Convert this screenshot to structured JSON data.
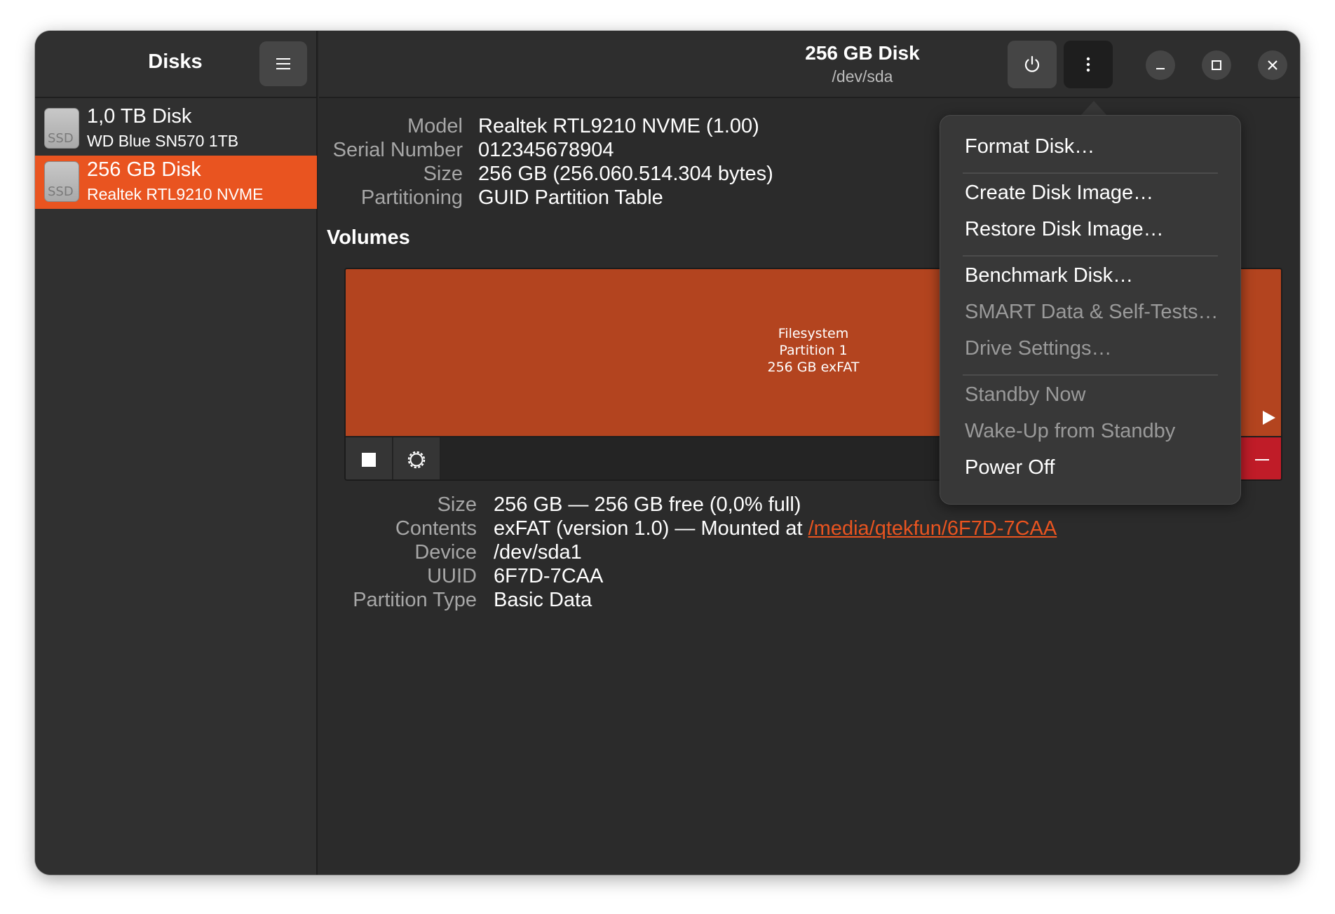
{
  "sidebar": {
    "title": "Disks",
    "disks": [
      {
        "icon_label": "SSD",
        "name": "1,0 TB Disk",
        "model": "WD Blue SN570 1TB"
      },
      {
        "icon_label": "SSD",
        "name": "256 GB Disk",
        "model": "Realtek RTL9210 NVME"
      }
    ]
  },
  "header": {
    "title": "256 GB Disk",
    "subtitle": "/dev/sda"
  },
  "drive_info": {
    "model_label": "Model",
    "model": "Realtek RTL9210 NVME (1.00)",
    "serial_label": "Serial Number",
    "serial": "012345678904",
    "size_label": "Size",
    "size": "256 GB (256.060.514.304 bytes)",
    "partitioning_label": "Partitioning",
    "partitioning": "GUID Partition Table"
  },
  "volumes": {
    "title": "Volumes",
    "partition": {
      "line1": "Filesystem",
      "line2": "Partition 1",
      "line3": "256 GB exFAT"
    }
  },
  "volume_info": {
    "size_label": "Size",
    "size": "256 GB — 256 GB free (0,0% full)",
    "contents_label": "Contents",
    "contents_prefix": "exFAT (version 1.0) — Mounted at ",
    "mount_path": "/media/qtekfun/6F7D-7CAA",
    "device_label": "Device",
    "device": "/dev/sda1",
    "uuid_label": "UUID",
    "uuid": "6F7D-7CAA",
    "partition_type_label": "Partition Type",
    "partition_type": "Basic Data"
  },
  "menu": {
    "format": "Format Disk…",
    "create_image": "Create Disk Image…",
    "restore_image": "Restore Disk Image…",
    "benchmark": "Benchmark Disk…",
    "smart": "SMART Data & Self-Tests…",
    "drive_settings": "Drive Settings…",
    "standby": "Standby Now",
    "wakeup": "Wake-Up from Standby",
    "power_off": "Power Off"
  },
  "colors": {
    "accent": "#e95420",
    "partition": "#b3441f",
    "window_bg": "#2b2b2b",
    "delete_button": "#c01c28"
  },
  "icons": [
    "hamburger-icon",
    "power-icon",
    "more-vertical-icon",
    "minimize-icon",
    "maximize-icon",
    "close-icon",
    "stop-icon",
    "gear-icon",
    "play-icon",
    "minus-icon"
  ]
}
